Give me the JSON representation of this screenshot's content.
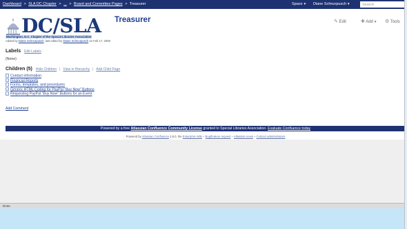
{
  "topbar": {
    "breadcrumbs": [
      "Dashboard",
      "SLA DC Chapter",
      "...",
      "Board and Committee Pages",
      "Treasurer"
    ],
    "breadcrumb_separator": ">",
    "space_label": "Space",
    "user_name": "Diane Schnurpusch",
    "search_placeholder": "Search"
  },
  "logo": {
    "text": "DC/SLA",
    "tagline": "Washington, D.C. Chapter of the Special Libraries Association"
  },
  "page": {
    "title": "Treasurer",
    "meta_added_by": "Added by",
    "meta_author": "Diane Schnurpusch",
    "meta_edited": ", last edited by",
    "meta_editor": "Diane Schnurpusch",
    "meta_date": "on Feb 17, 2008"
  },
  "actions": {
    "edit": "Edit",
    "add": "Add",
    "tools": "Tools"
  },
  "labels": {
    "heading": "Labels",
    "edit_link": "Edit Labels",
    "value": "(None)"
  },
  "children": {
    "heading": "Children (5)",
    "hide_link": "Hide Children",
    "hierarchy_link": "View in Hierarchy",
    "add_child_link": "Add Child Page",
    "items": [
      "Contact information",
      "Financial Reports",
      "Forms, templates, and procedures",
      "Generic HTML Coding for PayPal \"Buy Now\" Buttons",
      "Requesting PayPal \"Buy Now\" Buttons for an Event"
    ]
  },
  "add_comment": "Add Comment",
  "footer": {
    "powered_prefix": "Powered by a free",
    "license_name": "Atlassian Confluence Community License",
    "granted_text": "granted to Special Libraries Association.",
    "evaluate_link": "Evaluate Confluence today",
    "powered_by": "Powered by",
    "confluence_link": "Atlassian Confluence",
    "version": "2.8.0, the",
    "wiki_link": "Enterprise Wiki",
    "bug_link": "Bug/feature request",
    "news_link": "Atlassian news",
    "contact_link": "Contact administrators",
    "sep": "–"
  },
  "statusbar": {
    "text": "Done"
  },
  "colors": {
    "nav_bar": "#1e3272",
    "link": "#1d3f92",
    "logo": "#1c3a7a",
    "bottom_band": "#c4e6f8"
  }
}
